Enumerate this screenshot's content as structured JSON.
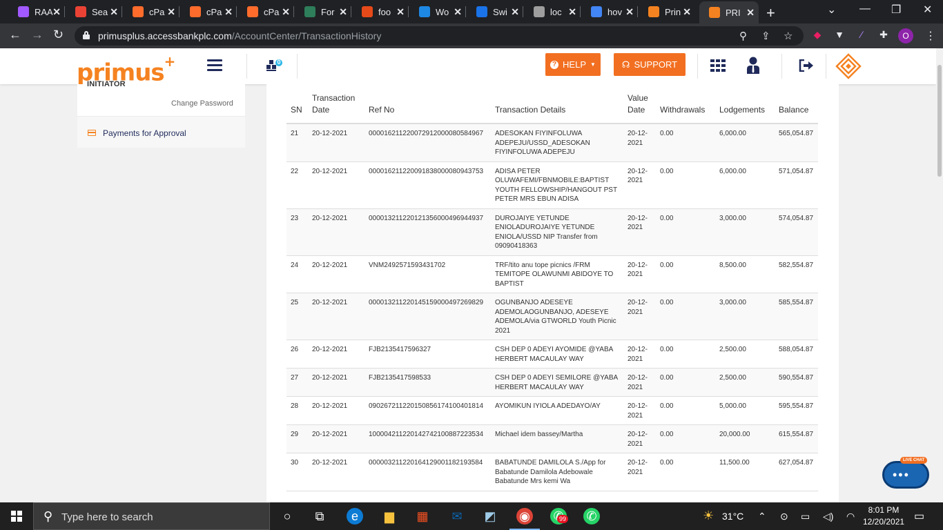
{
  "browser": {
    "tabs": [
      {
        "label": "RAA",
        "icon": "figma-icon",
        "color": "#a259ff"
      },
      {
        "label": "Sea",
        "icon": "gmail-icon",
        "color": "#ea4335"
      },
      {
        "label": "cPa",
        "icon": "cpanel-icon",
        "color": "#ff6c2c"
      },
      {
        "label": "cPa",
        "icon": "cpanel-icon",
        "color": "#ff6c2c"
      },
      {
        "label": "cPa",
        "icon": "cpanel-icon",
        "color": "#ff6c2c"
      },
      {
        "label": "For",
        "icon": "v-icon",
        "color": "#2e7d5b"
      },
      {
        "label": "foo",
        "icon": "app-icon",
        "color": "#e64a19"
      },
      {
        "label": "Wo",
        "icon": "window-icon",
        "color": "#1e88e5"
      },
      {
        "label": "Swi",
        "icon": "shield-icon",
        "color": "#1a73e8"
      },
      {
        "label": "loc",
        "icon": "shield-icon",
        "color": "#9e9e9e"
      },
      {
        "label": "hov",
        "icon": "google-icon",
        "color": "#4285f4"
      },
      {
        "label": "Prin",
        "icon": "access-icon",
        "color": "#f58220"
      },
      {
        "label": "PRI",
        "icon": "access-icon",
        "color": "#f58220",
        "active": true
      }
    ],
    "url_domain": "primusplus.accessbankplc.com",
    "url_path": "/AccountCenter/TransactionHistory",
    "profile_initial": "O"
  },
  "header": {
    "logo": "primus",
    "logo_plus": "+",
    "help_label": "HELP",
    "support_label": "SUPPORT",
    "badge": "0"
  },
  "sidebar": {
    "initiator": "INITIATOR",
    "change_password": "Change Password",
    "payments_for_approval": "Payments for Approval"
  },
  "table": {
    "headers": {
      "sn": "SN",
      "date_line1": "Transaction",
      "date_line2": "Date",
      "ref": "Ref No",
      "details": "Transaction Details",
      "vd_line1": "Value",
      "vd_line2": "Date",
      "withdrawals": "Withdrawals",
      "lodgements": "Lodgements",
      "balance": "Balance"
    },
    "rows": [
      {
        "sn": "21",
        "date": "20-12-2021",
        "ref": "000016211220072912000080584967",
        "details": "ADESOKAN FIYINFOLUWA ADEPEJU/USSD_ADESOKAN FIYINFOLUWA ADEPEJU",
        "vd": "20-12-2021",
        "w": "0.00",
        "l": "6,000.00",
        "b": "565,054.87"
      },
      {
        "sn": "22",
        "date": "20-12-2021",
        "ref": "000016211220091838000080943753",
        "details": "ADISA PETER OLUWAFEMI/FBNMOBILE:BAPTIST YOUTH FELLOWSHIP/HANGOUT PST PETER MRS EBUN ADISA",
        "vd": "20-12-2021",
        "w": "0.00",
        "l": "6,000.00",
        "b": "571,054.87"
      },
      {
        "sn": "23",
        "date": "20-12-2021",
        "ref": "000013211220121356000496944937",
        "details": "DUROJAIYE YETUNDE ENIOLADUROJAIYE YETUNDE ENIOLA/USSD NIP Transfer from 09090418363",
        "vd": "20-12-2021",
        "w": "0.00",
        "l": "3,000.00",
        "b": "574,054.87"
      },
      {
        "sn": "24",
        "date": "20-12-2021",
        "ref": "VNM2492571593431702",
        "details": "TRF/tito anu tope picnics /FRM TEMITOPE OLAWUNMI ABIDOYE TO BAPTIST",
        "vd": "20-12-2021",
        "w": "0.00",
        "l": "8,500.00",
        "b": "582,554.87"
      },
      {
        "sn": "25",
        "date": "20-12-2021",
        "ref": "000013211220145159000497269829",
        "details": "OGUNBANJO ADESEYE ADEMOLAOGUNBANJO, ADESEYE ADEMOLA/via GTWORLD Youth Picnic 2021",
        "vd": "20-12-2021",
        "w": "0.00",
        "l": "3,000.00",
        "b": "585,554.87"
      },
      {
        "sn": "26",
        "date": "20-12-2021",
        "ref": "FJB2135417596327",
        "details": "CSH DEP 0 ADEYI AYOMIDE @YABA HERBERT MACAULAY WAY",
        "vd": "20-12-2021",
        "w": "0.00",
        "l": "2,500.00",
        "b": "588,054.87"
      },
      {
        "sn": "27",
        "date": "20-12-2021",
        "ref": "FJB2135417598533",
        "details": "CSH DEP 0 ADEYI SEMILORE @YABA HERBERT MACAULAY WAY",
        "vd": "20-12-2021",
        "w": "0.00",
        "l": "2,500.00",
        "b": "590,554.87"
      },
      {
        "sn": "28",
        "date": "20-12-2021",
        "ref": "090267211220150856174100401814",
        "details": "AYOMIKUN IYIOLA ADEDAYO/AY",
        "vd": "20-12-2021",
        "w": "0.00",
        "l": "5,000.00",
        "b": "595,554.87"
      },
      {
        "sn": "29",
        "date": "20-12-2021",
        "ref": "100004211220142742100887223534",
        "details": "Michael idem bassey/Martha",
        "vd": "20-12-2021",
        "w": "0.00",
        "l": "20,000.00",
        "b": "615,554.87"
      },
      {
        "sn": "30",
        "date": "20-12-2021",
        "ref": "000003211220164129001182193584",
        "details": "BABATUNDE DAMILOLA S./App for Babatunde Damilola Adebowale Babatunde Mrs kemi Wa",
        "vd": "20-12-2021",
        "w": "0.00",
        "l": "11,500.00",
        "b": "627,054.87"
      }
    ]
  },
  "livechat": {
    "tag": "LIVE CHAT"
  },
  "taskbar": {
    "search_placeholder": "Type here to search",
    "weather": "31°C",
    "time": "8:01 PM",
    "date": "12/20/2021",
    "whatsapp_badge": "99"
  },
  "colors": {
    "brand_orange": "#f26f21",
    "brand_navy": "#1f2a5a"
  }
}
